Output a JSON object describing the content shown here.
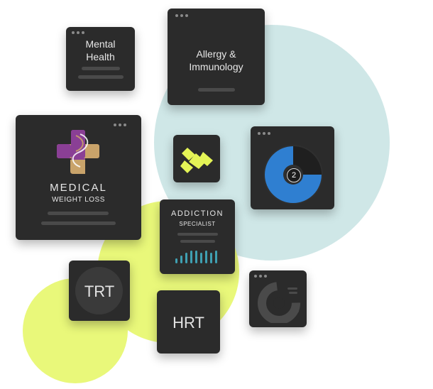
{
  "colors": {
    "teal_circle": "#cfe7e7",
    "lime_circle": "#e9f87a",
    "card_bg": "#2b2b2b",
    "skeleton": "#4a4a4a",
    "accent_blue": "#2f7fd1",
    "accent_lime": "#e4f456",
    "accent_teal": "#3fa0b2",
    "logo_purple": "#8a3f95",
    "logo_tan": "#c9a36a"
  },
  "cards": {
    "mental_health": {
      "line1": "Mental",
      "line2": "Health"
    },
    "allergy": {
      "line1": "Allergy &",
      "line2": "Immunology"
    },
    "medical_weight_loss": {
      "title": "MEDICAL",
      "subtitle": "WEIGHT LOSS",
      "logo_icon": "medical-cross-logo-icon"
    },
    "brand_logo": {
      "icon": "lime-brand-logo-icon"
    },
    "stats": {
      "badge": "2",
      "icon": "blue-donut-chart-icon"
    },
    "addiction": {
      "title": "ADDICTION",
      "subtitle": "SPECIALIST",
      "bar_levels": [
        0.35,
        0.55,
        0.75,
        0.9,
        0.9,
        0.75,
        0.9,
        0.75,
        0.9
      ]
    },
    "trt": {
      "label": "TRT"
    },
    "hrt": {
      "label": "HRT"
    },
    "small_chart": {
      "icon": "dark-donut-chart-icon"
    }
  }
}
